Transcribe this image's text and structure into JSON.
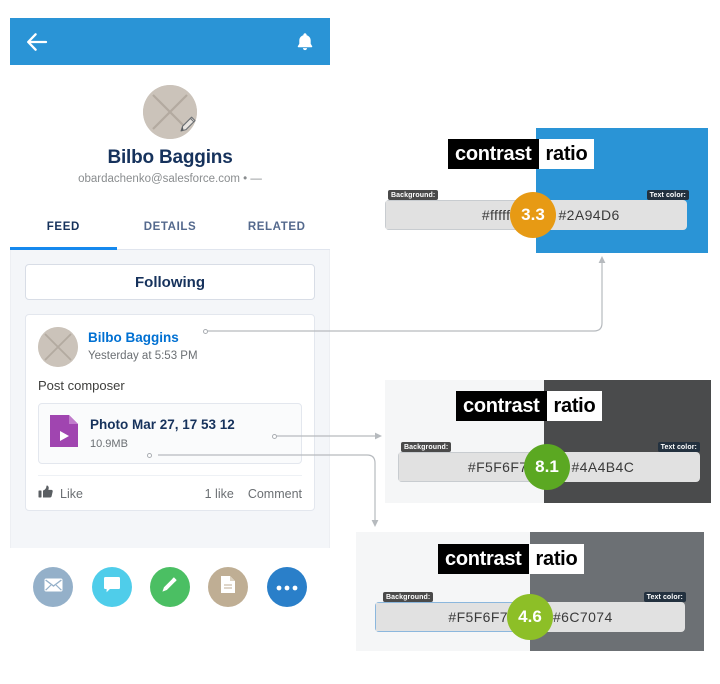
{
  "app": {
    "back_icon": "back-arrow-icon",
    "bell_icon": "notification-bell-icon",
    "appbar_color": "#2A94D6"
  },
  "profile": {
    "name": "Bilbo Baggins",
    "subtitle": "obardachenko@salesforce.com  •  —",
    "avatar_icon": "user-avatar-placeholder",
    "edit_icon": "pencil-edit-icon"
  },
  "tabs": [
    {
      "label": "FEED",
      "active": true
    },
    {
      "label": "DETAILS",
      "active": false
    },
    {
      "label": "RELATED",
      "active": false
    }
  ],
  "feed": {
    "following_label": "Following",
    "post": {
      "author": "Bilbo Baggins",
      "timestamp": "Yesterday at 5:53 PM",
      "body": "Post composer",
      "attachment": {
        "title": "Photo Mar 27, 17 53 12",
        "size": "10.9MB",
        "icon": "video-file-icon",
        "icon_color": "#A045B0"
      },
      "actions": {
        "like_label": "Like",
        "like_icon": "thumbs-up-icon",
        "like_count": "1 like",
        "comment_label": "Comment"
      }
    }
  },
  "fab_bar": [
    {
      "name": "email",
      "icon": "envelope-icon",
      "color": "#94b0c9"
    },
    {
      "name": "chat",
      "icon": "speech-bubble-icon",
      "color": "#4fcdea"
    },
    {
      "name": "edit",
      "icon": "pencil-icon",
      "color": "#4bbf63"
    },
    {
      "name": "file",
      "icon": "document-icon",
      "color": "#bfae94"
    },
    {
      "name": "more",
      "icon": "ellipsis-icon",
      "color": "#2a7fc9"
    }
  ],
  "contrast_panels": [
    {
      "id": "panel-blue",
      "word1": "contrast",
      "word2": "ratio",
      "bg_label": "Background:",
      "fg_label": "Text color:",
      "bg_value": "#ffffff",
      "fg_value": "#2A94D6",
      "ratio": "3.3",
      "badge_color": "#E79A14",
      "left_color": "#ffffff",
      "right_color": "#2A94D6"
    },
    {
      "id": "panel-dark",
      "word1": "contrast",
      "word2": "ratio",
      "bg_label": "Background:",
      "fg_label": "Text color:",
      "bg_value": "#F5F6F7",
      "fg_value": "#4A4B4C",
      "ratio": "8.1",
      "badge_color": "#5BA822",
      "left_color": "#F5F6F7",
      "right_color": "#4A4B4C"
    },
    {
      "id": "panel-gray",
      "word1": "contrast",
      "word2": "ratio",
      "bg_label": "Background:",
      "fg_label": "Text color:",
      "bg_value": "#F5F6F7",
      "fg_value": "#6C7074",
      "ratio": "4.6",
      "badge_color": "#8DBF27",
      "left_color": "#F5F6F7",
      "right_color": "#6C7074"
    }
  ]
}
